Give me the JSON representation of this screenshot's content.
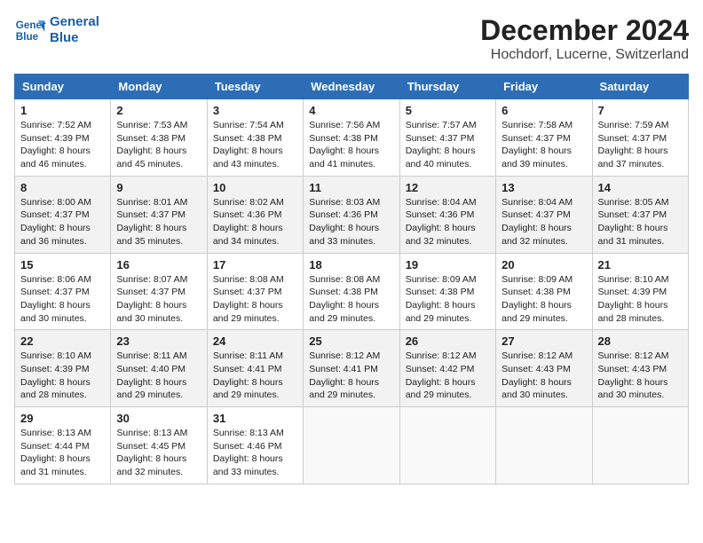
{
  "header": {
    "logo_line1": "General",
    "logo_line2": "Blue",
    "title": "December 2024",
    "subtitle": "Hochdorf, Lucerne, Switzerland"
  },
  "days_of_week": [
    "Sunday",
    "Monday",
    "Tuesday",
    "Wednesday",
    "Thursday",
    "Friday",
    "Saturday"
  ],
  "weeks": [
    [
      {
        "day": "1",
        "lines": [
          "Sunrise: 7:52 AM",
          "Sunset: 4:39 PM",
          "Daylight: 8 hours",
          "and 46 minutes."
        ]
      },
      {
        "day": "2",
        "lines": [
          "Sunrise: 7:53 AM",
          "Sunset: 4:38 PM",
          "Daylight: 8 hours",
          "and 45 minutes."
        ]
      },
      {
        "day": "3",
        "lines": [
          "Sunrise: 7:54 AM",
          "Sunset: 4:38 PM",
          "Daylight: 8 hours",
          "and 43 minutes."
        ]
      },
      {
        "day": "4",
        "lines": [
          "Sunrise: 7:56 AM",
          "Sunset: 4:38 PM",
          "Daylight: 8 hours",
          "and 41 minutes."
        ]
      },
      {
        "day": "5",
        "lines": [
          "Sunrise: 7:57 AM",
          "Sunset: 4:37 PM",
          "Daylight: 8 hours",
          "and 40 minutes."
        ]
      },
      {
        "day": "6",
        "lines": [
          "Sunrise: 7:58 AM",
          "Sunset: 4:37 PM",
          "Daylight: 8 hours",
          "and 39 minutes."
        ]
      },
      {
        "day": "7",
        "lines": [
          "Sunrise: 7:59 AM",
          "Sunset: 4:37 PM",
          "Daylight: 8 hours",
          "and 37 minutes."
        ]
      }
    ],
    [
      {
        "day": "8",
        "lines": [
          "Sunrise: 8:00 AM",
          "Sunset: 4:37 PM",
          "Daylight: 8 hours",
          "and 36 minutes."
        ]
      },
      {
        "day": "9",
        "lines": [
          "Sunrise: 8:01 AM",
          "Sunset: 4:37 PM",
          "Daylight: 8 hours",
          "and 35 minutes."
        ]
      },
      {
        "day": "10",
        "lines": [
          "Sunrise: 8:02 AM",
          "Sunset: 4:36 PM",
          "Daylight: 8 hours",
          "and 34 minutes."
        ]
      },
      {
        "day": "11",
        "lines": [
          "Sunrise: 8:03 AM",
          "Sunset: 4:36 PM",
          "Daylight: 8 hours",
          "and 33 minutes."
        ]
      },
      {
        "day": "12",
        "lines": [
          "Sunrise: 8:04 AM",
          "Sunset: 4:36 PM",
          "Daylight: 8 hours",
          "and 32 minutes."
        ]
      },
      {
        "day": "13",
        "lines": [
          "Sunrise: 8:04 AM",
          "Sunset: 4:37 PM",
          "Daylight: 8 hours",
          "and 32 minutes."
        ]
      },
      {
        "day": "14",
        "lines": [
          "Sunrise: 8:05 AM",
          "Sunset: 4:37 PM",
          "Daylight: 8 hours",
          "and 31 minutes."
        ]
      }
    ],
    [
      {
        "day": "15",
        "lines": [
          "Sunrise: 8:06 AM",
          "Sunset: 4:37 PM",
          "Daylight: 8 hours",
          "and 30 minutes."
        ]
      },
      {
        "day": "16",
        "lines": [
          "Sunrise: 8:07 AM",
          "Sunset: 4:37 PM",
          "Daylight: 8 hours",
          "and 30 minutes."
        ]
      },
      {
        "day": "17",
        "lines": [
          "Sunrise: 8:08 AM",
          "Sunset: 4:37 PM",
          "Daylight: 8 hours",
          "and 29 minutes."
        ]
      },
      {
        "day": "18",
        "lines": [
          "Sunrise: 8:08 AM",
          "Sunset: 4:38 PM",
          "Daylight: 8 hours",
          "and 29 minutes."
        ]
      },
      {
        "day": "19",
        "lines": [
          "Sunrise: 8:09 AM",
          "Sunset: 4:38 PM",
          "Daylight: 8 hours",
          "and 29 minutes."
        ]
      },
      {
        "day": "20",
        "lines": [
          "Sunrise: 8:09 AM",
          "Sunset: 4:38 PM",
          "Daylight: 8 hours",
          "and 29 minutes."
        ]
      },
      {
        "day": "21",
        "lines": [
          "Sunrise: 8:10 AM",
          "Sunset: 4:39 PM",
          "Daylight: 8 hours",
          "and 28 minutes."
        ]
      }
    ],
    [
      {
        "day": "22",
        "lines": [
          "Sunrise: 8:10 AM",
          "Sunset: 4:39 PM",
          "Daylight: 8 hours",
          "and 28 minutes."
        ]
      },
      {
        "day": "23",
        "lines": [
          "Sunrise: 8:11 AM",
          "Sunset: 4:40 PM",
          "Daylight: 8 hours",
          "and 29 minutes."
        ]
      },
      {
        "day": "24",
        "lines": [
          "Sunrise: 8:11 AM",
          "Sunset: 4:41 PM",
          "Daylight: 8 hours",
          "and 29 minutes."
        ]
      },
      {
        "day": "25",
        "lines": [
          "Sunrise: 8:12 AM",
          "Sunset: 4:41 PM",
          "Daylight: 8 hours",
          "and 29 minutes."
        ]
      },
      {
        "day": "26",
        "lines": [
          "Sunrise: 8:12 AM",
          "Sunset: 4:42 PM",
          "Daylight: 8 hours",
          "and 29 minutes."
        ]
      },
      {
        "day": "27",
        "lines": [
          "Sunrise: 8:12 AM",
          "Sunset: 4:43 PM",
          "Daylight: 8 hours",
          "and 30 minutes."
        ]
      },
      {
        "day": "28",
        "lines": [
          "Sunrise: 8:12 AM",
          "Sunset: 4:43 PM",
          "Daylight: 8 hours",
          "and 30 minutes."
        ]
      }
    ],
    [
      {
        "day": "29",
        "lines": [
          "Sunrise: 8:13 AM",
          "Sunset: 4:44 PM",
          "Daylight: 8 hours",
          "and 31 minutes."
        ]
      },
      {
        "day": "30",
        "lines": [
          "Sunrise: 8:13 AM",
          "Sunset: 4:45 PM",
          "Daylight: 8 hours",
          "and 32 minutes."
        ]
      },
      {
        "day": "31",
        "lines": [
          "Sunrise: 8:13 AM",
          "Sunset: 4:46 PM",
          "Daylight: 8 hours",
          "and 33 minutes."
        ]
      },
      null,
      null,
      null,
      null
    ]
  ]
}
